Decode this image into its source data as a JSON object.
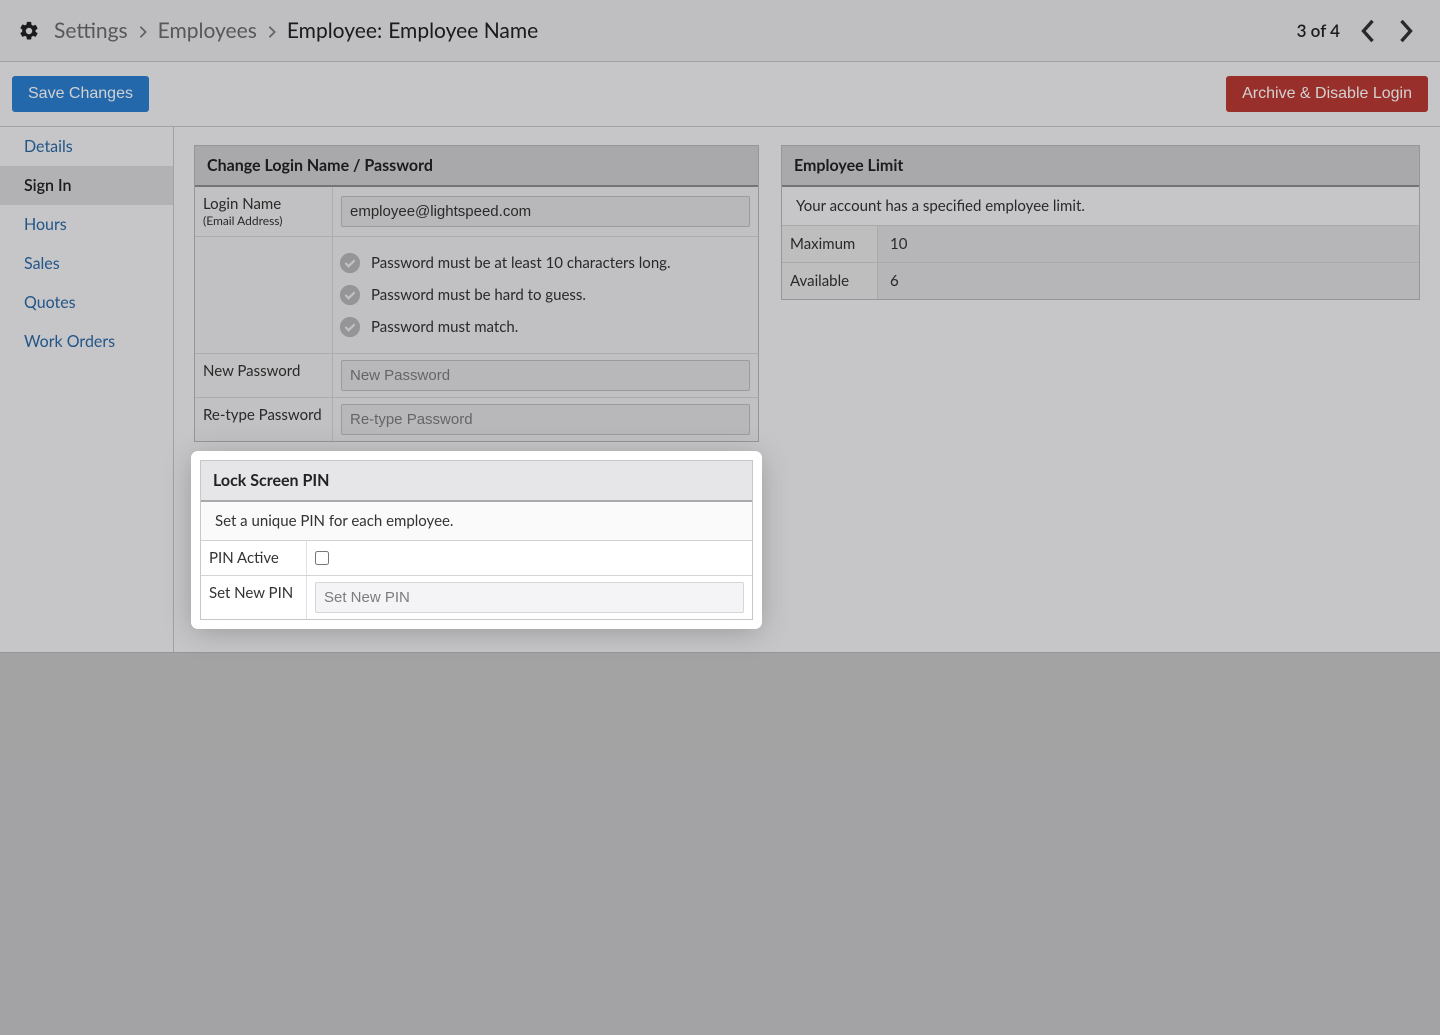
{
  "breadcrumb": {
    "settings": "Settings",
    "employees": "Employees",
    "employee_label": "Employee:",
    "employee_name": "Employee Name"
  },
  "pager": {
    "text": "3 of 4"
  },
  "actions": {
    "save": "Save Changes",
    "archive": "Archive & Disable Login"
  },
  "sidebar": {
    "items": [
      {
        "label": "Details"
      },
      {
        "label": "Sign In"
      },
      {
        "label": "Hours"
      },
      {
        "label": "Sales"
      },
      {
        "label": "Quotes"
      },
      {
        "label": "Work Orders"
      }
    ],
    "active_index": 1
  },
  "login_panel": {
    "title": "Change Login Name / Password",
    "login_name_label": "Login Name",
    "login_name_sub": "(Email Address)",
    "login_name_value": "employee@lightspeed.com",
    "rules": [
      "Password must be at least 10 characters long.",
      "Password must be hard to guess.",
      "Password must match."
    ],
    "new_pw_label": "New Password",
    "new_pw_placeholder": "New Password",
    "retype_label": "Re-type Password",
    "retype_placeholder": "Re-type Password"
  },
  "pin_panel": {
    "title": "Lock Screen PIN",
    "note": "Set a unique PIN for each employee.",
    "active_label": "PIN Active",
    "active_checked": false,
    "set_label": "Set New PIN",
    "set_placeholder": "Set New PIN"
  },
  "limit_panel": {
    "title": "Employee Limit",
    "note": "Your account has a specified employee limit.",
    "max_label": "Maximum",
    "max_value": "10",
    "avail_label": "Available",
    "avail_value": "6"
  }
}
